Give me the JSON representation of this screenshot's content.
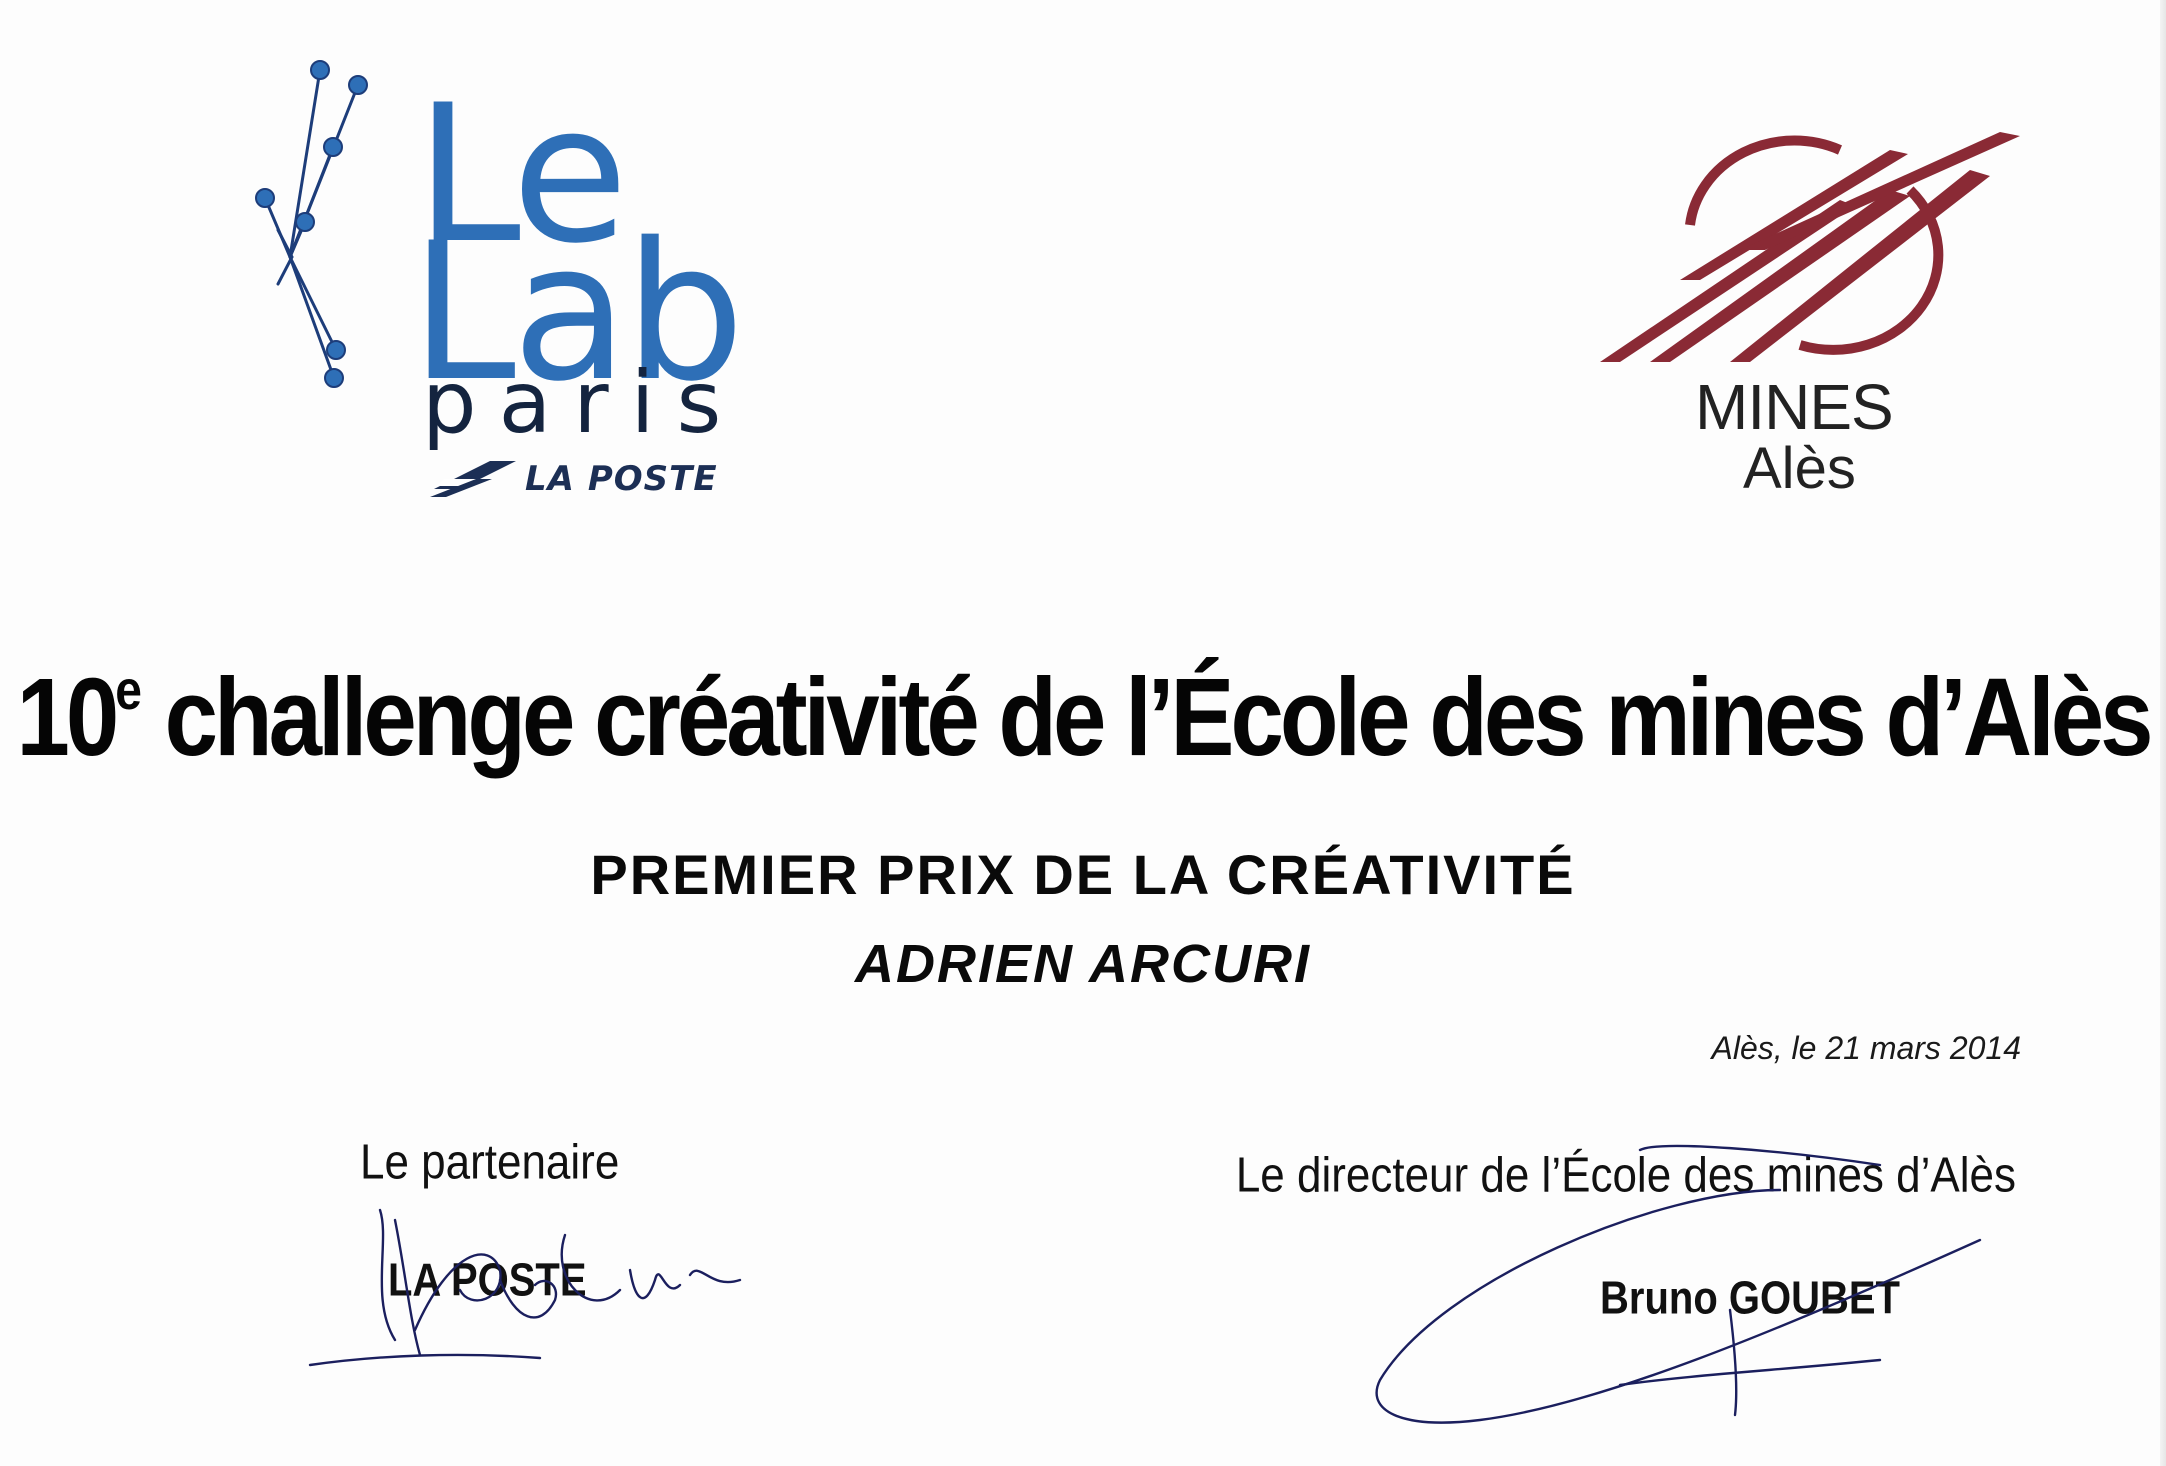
{
  "logos": {
    "lab": {
      "line1": "Le",
      "line2": "Lab",
      "line3": "paris",
      "sub": "LA POSTE",
      "color_primary": "#2e6fb7",
      "color_dark": "#14243f"
    },
    "mines": {
      "line1": "MINES",
      "line2": "Alès",
      "color_primary": "#8a2a35"
    }
  },
  "title": {
    "prefix": "10",
    "ordinal": "e",
    "text": " challenge créativité de l’École des mines d’Alès"
  },
  "prize": "PREMIER PRIX DE LA CRÉATIVITÉ",
  "laureate": "ADRIEN ARCURI",
  "date_line": "Alès, le 21 mars 2014",
  "signatures": {
    "partner": {
      "label": "Le partenaire",
      "name": "LA POSTE"
    },
    "director": {
      "label": "Le directeur de l’École des mines d’Alès",
      "name": "Bruno GOUBET"
    },
    "ink_color": "#1b1f5e"
  }
}
